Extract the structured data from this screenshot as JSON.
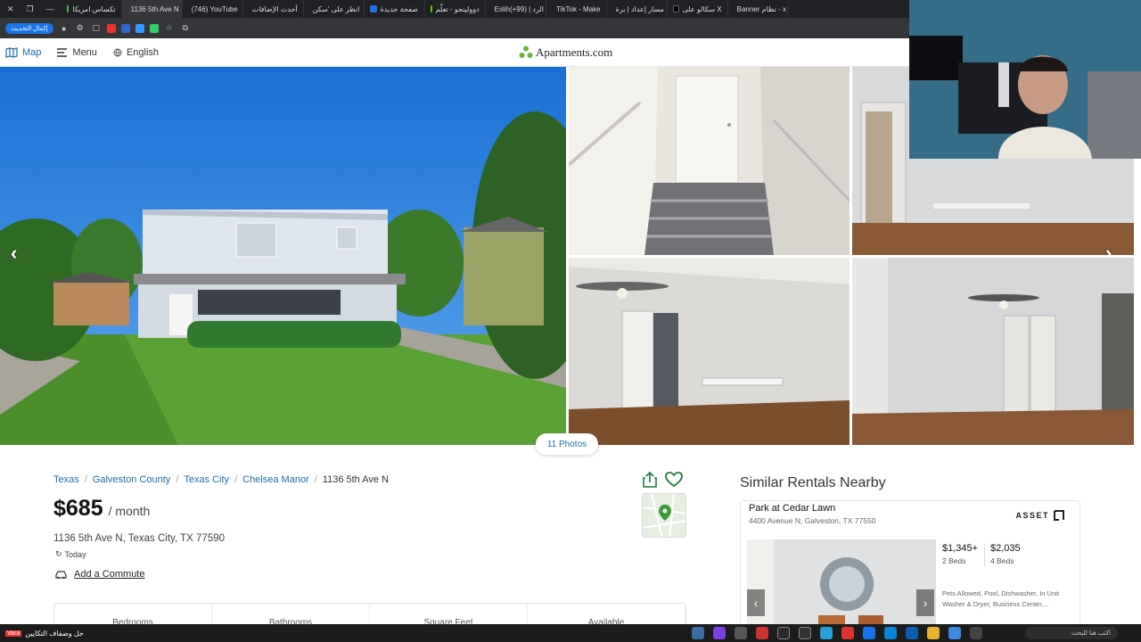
{
  "browser": {
    "tabs": [
      {
        "label": "Banner نظام - x"
      },
      {
        "label": "سكالو على X"
      },
      {
        "label": "مسار إعداد | برة"
      },
      {
        "label": "TikTok - Make"
      },
      {
        "label": "Eslih(+99) | الرد"
      },
      {
        "label": "دوولينجو - تعلّم"
      },
      {
        "label": "صفحة جديدة"
      },
      {
        "label": "انظر على 'سكن"
      },
      {
        "label": "أحدث الإضافات"
      },
      {
        "label": "(746) YouTube"
      },
      {
        "label": "1136 5th Ave N"
      },
      {
        "label": "تكساس امريكا"
      }
    ],
    "update_button": "إكمال التحديث"
  },
  "header": {
    "map_label": "Map",
    "menu_label": "Menu",
    "language_label": "English",
    "logo_text": "Apartments.com"
  },
  "gallery": {
    "photos_button": "11 Photos"
  },
  "listing": {
    "breadcrumbs": [
      "Texas",
      "Galveston County",
      "Texas City",
      "Chelsea Manor",
      "1136 5th Ave N"
    ],
    "price": "$685",
    "price_period": "/ month",
    "address": "1136 5th Ave N, Texas City, TX 77590",
    "updated": "Today",
    "commute_label": "Add a Commute",
    "stats": [
      "Bedrooms",
      "Bathrooms",
      "Square Feet",
      "Available"
    ]
  },
  "similar": {
    "title": "Similar Rentals Nearby",
    "card": {
      "name": "Park at Cedar Lawn",
      "address": "4400 Avenue N, Galveston, TX 77550",
      "brand": "ASSET",
      "price_1": "$1,345+",
      "beds_1": "2 Beds",
      "price_2": "$2,035",
      "beds_2": "4 Beds",
      "amenities": "Pets Allowed, Pool, Dishwasher, In Unit Washer & Dryer, Business Center,..."
    }
  },
  "taskbar": {
    "ticker_badge": "Vara",
    "ticker_text": "حل وضفاف التكايين",
    "search_placeholder": "اكتب هنا للبحث"
  },
  "colors": {
    "link": "#1e6fa8",
    "logo_green": "#6cb33f"
  }
}
